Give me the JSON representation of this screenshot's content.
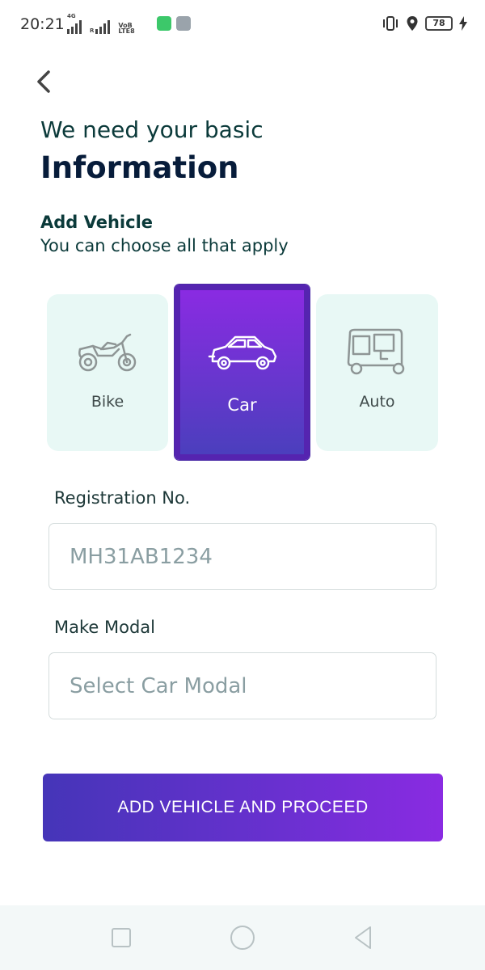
{
  "status_bar": {
    "time": "20:21",
    "net_left": "4G",
    "net_right": "R",
    "volte_top": "VoB",
    "volte_bottom": "LTE8",
    "battery": "78"
  },
  "header": {
    "line1": "We need your basic",
    "line2": "Information"
  },
  "section": {
    "title": "Add Vehicle",
    "subtitle": "You can choose all that apply"
  },
  "vehicles": [
    {
      "label": "Bike",
      "selected": false
    },
    {
      "label": "Car",
      "selected": true
    },
    {
      "label": "Auto",
      "selected": false
    }
  ],
  "registration": {
    "label": "Registration No.",
    "placeholder": "MH31AB1234"
  },
  "make_modal": {
    "label": "Make Modal",
    "placeholder": "Select Car Modal"
  },
  "cta": {
    "label": "ADD VEHICLE AND PROCEED"
  },
  "colors": {
    "accent": "#8a2be2",
    "accent_dark": "#4535b8",
    "card_bg": "#e8f8f5"
  }
}
